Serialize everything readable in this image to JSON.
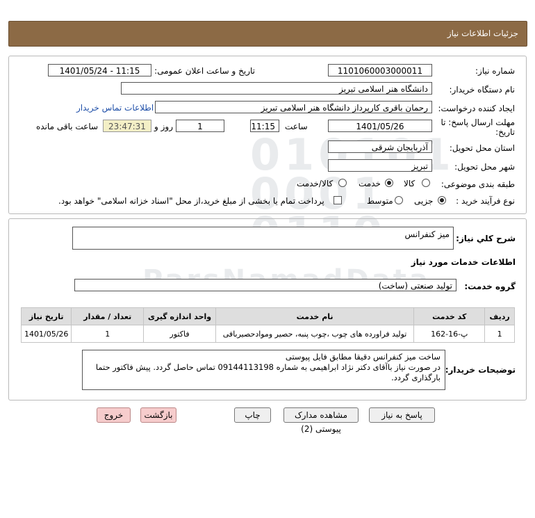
{
  "header": {
    "title": "جزئیات اطلاعات نیاز"
  },
  "fields": {
    "need_number_label": "شماره نیاز:",
    "need_number": "1101060003000011",
    "announce_label": "تاریخ و ساعت اعلان عمومی:",
    "announce_value": "1401/05/24 - 11:15",
    "buyer_org_label": "نام دستگاه خریدار:",
    "buyer_org": "دانشگاه هنر اسلامی تبریز",
    "requester_label": "ایجاد کننده درخواست:",
    "requester": "رحمان باقری کارپرداز دانشگاه هنر اسلامی تبریز",
    "contact_link": "اطلاعات تماس خریدار",
    "deadline_label_1": "مهلت ارسال پاسخ: تا",
    "deadline_label_2": "تاریخ:",
    "deadline_date": "1401/05/26",
    "time_label": "ساعت",
    "deadline_time": "11:15",
    "days_value": "1",
    "days_label": "روز و",
    "remaining_time": "23:47:31",
    "remaining_label": "ساعت باقی مانده",
    "province_label": "استان محل تحویل:",
    "province": "آذربایجان شرقی",
    "city_label": "شهر محل تحویل:",
    "city": "تبریز",
    "category_label": "طبقه بندی موضوعی:",
    "category_options": [
      "کالا",
      "خدمت",
      "کالا/خدمت"
    ],
    "category_selected": "خدمت",
    "process_label": "نوع فرآیند خرید :",
    "process_options": [
      "جزیی",
      "متوسط"
    ],
    "process_selected": "جزیی",
    "payment_note": "پرداخت تمام یا بخشی از مبلغ خرید،از محل \"اسناد خزانه اسلامی\" خواهد بود."
  },
  "summary": {
    "label": "شرح کلي نیاز:",
    "value": "میز کنفرانس",
    "services_title": "اطلاعات خدمات مورد نیاز",
    "group_label": "گروه خدمت:",
    "group_value": "تولید صنعتی (ساخت)"
  },
  "table": {
    "headers": [
      "ردیف",
      "کد خدمت",
      "نام خدمت",
      "واحد اندازه گیری",
      "تعداد / مقدار",
      "تاریخ نیاز"
    ],
    "rows": [
      [
        "1",
        "پ-16-162",
        "تولید فراورده های چوب ،چوب پنبه، حصیر وموادحصیربافی",
        "فاکتور",
        "1",
        "1401/05/26"
      ]
    ]
  },
  "notes": {
    "label": "توضیحات خریدار:",
    "line1": "ساخت میز کنفرانس دقیقا مطابق فایل پیوستی",
    "line2": "در صورت نیاز باآقای دکتر نژاد ابراهیمی به شماره 09144113198 تماس حاصل گردد. پیش فاکتور حتما بارگذاری گردد."
  },
  "buttons": {
    "reply": "پاسخ به نیاز",
    "docs": "مشاهده مدارک پیوستی (2)",
    "print": "چاپ",
    "back": "بازگشت",
    "exit": "خروج"
  },
  "watermark": {
    "digits_1": "010101",
    "digits_2": "0001",
    "digits_3": "0110",
    "brand": "ParsNamadData"
  }
}
